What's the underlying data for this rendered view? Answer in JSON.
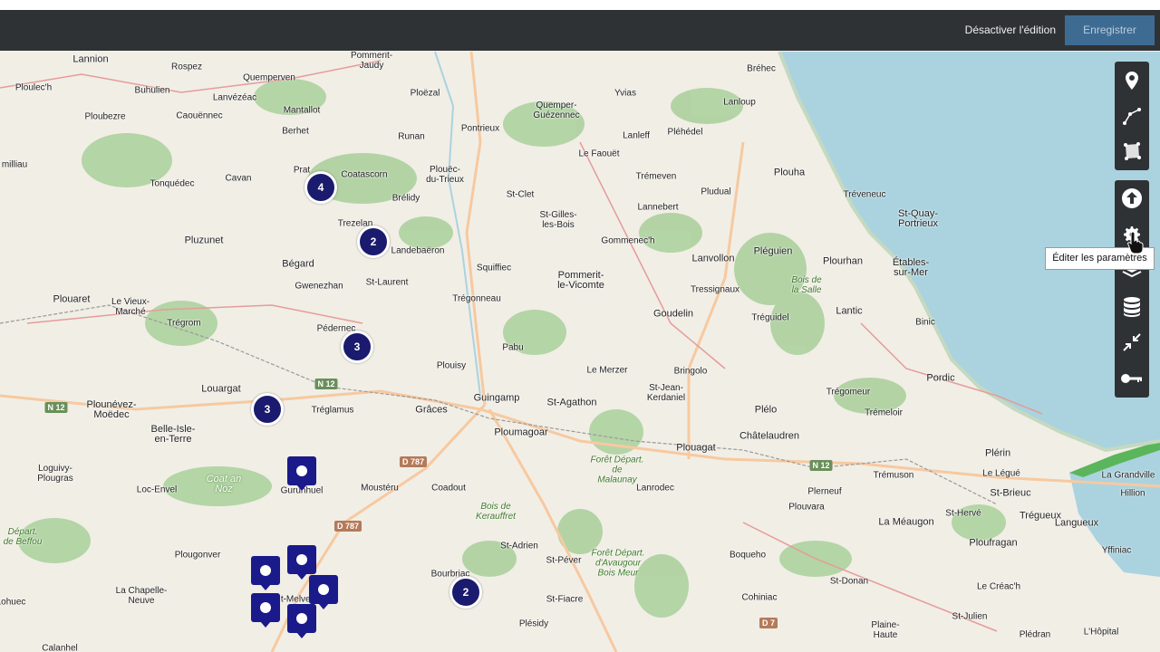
{
  "header": {
    "disable_edit_label": "Désactiver l'édition",
    "save_label": "Enregistrer"
  },
  "tooltip": {
    "text": "Éditer les paramètres"
  },
  "toolbar_top": {
    "icons": [
      "marker-pin-icon",
      "polyline-icon",
      "polygon-icon"
    ]
  },
  "toolbar_bottom": {
    "icons": [
      "upload-icon",
      "gear-icon",
      "layers-icon",
      "database-icon",
      "shrink-icon",
      "key-icon"
    ]
  },
  "places": [
    {
      "name": "Lannion"
    },
    {
      "name": "Rospez"
    },
    {
      "name": "Pommerit-\nJaudy"
    },
    {
      "name": "Quemperven"
    },
    {
      "name": "Ploulec'h"
    },
    {
      "name": "Buhulien"
    },
    {
      "name": "Lanvézéac"
    },
    {
      "name": "Ploubezre"
    },
    {
      "name": "Caouënnec"
    },
    {
      "name": "Mantallot"
    },
    {
      "name": "Berhet"
    },
    {
      "name": "Ploëzal"
    },
    {
      "name": "Runan"
    },
    {
      "name": "Pontrieux"
    },
    {
      "name": "Quemper-\nGuézennec"
    },
    {
      "name": "Yvias"
    },
    {
      "name": "Lanloup"
    },
    {
      "name": "Bréhec"
    },
    {
      "name": "Lanleff"
    },
    {
      "name": "Pléhédel"
    },
    {
      "name": "Le Faouët"
    },
    {
      "name": "Trémeven"
    },
    {
      "name": "Plouha"
    },
    {
      "name": "Tréveneuc"
    },
    {
      "name": "Pludual"
    },
    {
      "name": "Lannebert"
    },
    {
      "name": "Gommenec'h"
    },
    {
      "name": "Plouëc-\ndu-Trieux"
    },
    {
      "name": "St-Clet"
    },
    {
      "name": "St-Gilles-\nles-Bois"
    },
    {
      "name": "Coatascorn"
    },
    {
      "name": "Prat"
    },
    {
      "name": "Tonquédec"
    },
    {
      "name": "Cavan"
    },
    {
      "name": "milliau"
    },
    {
      "name": "Brélidy"
    },
    {
      "name": "Trezelan"
    },
    {
      "name": "Landebaëron"
    },
    {
      "name": "Pluzunet"
    },
    {
      "name": "Bégard"
    },
    {
      "name": "Gwenezhan"
    },
    {
      "name": "St-Laurent"
    },
    {
      "name": "Squiffiec"
    },
    {
      "name": "Trégonneau"
    },
    {
      "name": "Pommerit-\nle-Vicomte"
    },
    {
      "name": "Lanvollon"
    },
    {
      "name": "Pléguien"
    },
    {
      "name": "Plourhan"
    },
    {
      "name": "Étables-\nsur-Mer"
    },
    {
      "name": "St-Quay-\nPortrieux"
    },
    {
      "name": "Tressignaux"
    },
    {
      "name": "Tréguidel"
    },
    {
      "name": "Lantic"
    },
    {
      "name": "Binic"
    },
    {
      "name": "Goudelin"
    },
    {
      "name": "Plouaret"
    },
    {
      "name": "Le Vieux-\nMarché"
    },
    {
      "name": "Trégrom"
    },
    {
      "name": "Pédernec"
    },
    {
      "name": "Pabu"
    },
    {
      "name": "Plouisy"
    },
    {
      "name": "Le Merzer"
    },
    {
      "name": "Bringolo"
    },
    {
      "name": "Pordic"
    },
    {
      "name": "Trégomeur"
    },
    {
      "name": "St-Jean-\nKerdaniel"
    },
    {
      "name": "Louargat"
    },
    {
      "name": "Guingamp"
    },
    {
      "name": "St-Agathon"
    },
    {
      "name": "Plélo"
    },
    {
      "name": "Trémeloir"
    },
    {
      "name": "Plounévez-\nMoëdec"
    },
    {
      "name": "Tréglamus"
    },
    {
      "name": "Grâces"
    },
    {
      "name": "Ploumagoar"
    },
    {
      "name": "Plouagat"
    },
    {
      "name": "Châtelaudren"
    },
    {
      "name": "Belle-Isle-\nen-Terre"
    },
    {
      "name": "Plérin"
    },
    {
      "name": "Trémuson"
    },
    {
      "name": "Le Légué"
    },
    {
      "name": "St-Brieuc"
    },
    {
      "name": "La Grandville"
    },
    {
      "name": "Hillion"
    },
    {
      "name": "Loguivy-\nPlougras"
    },
    {
      "name": "Loc-Envel"
    },
    {
      "name": "Gurunhuel"
    },
    {
      "name": "Moustéru"
    },
    {
      "name": "Coadout"
    },
    {
      "name": "Lanrodec"
    },
    {
      "name": "Plerneuf"
    },
    {
      "name": "Plouvara"
    },
    {
      "name": "La Méaugon"
    },
    {
      "name": "St-Hervé"
    },
    {
      "name": "Trégueux"
    },
    {
      "name": "Langueux"
    },
    {
      "name": "Yffiniac"
    },
    {
      "name": "Ploufragan"
    },
    {
      "name": "Plougonver"
    },
    {
      "name": "St-Adrien"
    },
    {
      "name": "St-Péver"
    },
    {
      "name": "Boqueho"
    },
    {
      "name": "La Chapelle-\nNeuve"
    },
    {
      "name": "Bourbriac"
    },
    {
      "name": "St-Fiacre"
    },
    {
      "name": "Cohiniac"
    },
    {
      "name": "St-Donan"
    },
    {
      "name": "Le Créac'h"
    },
    {
      "name": "Plésidy"
    },
    {
      "name": "Plaine-\nHaute"
    },
    {
      "name": "St-Julien"
    },
    {
      "name": "Calanhel"
    },
    {
      "name": "Plédran"
    },
    {
      "name": "L'Hôpital"
    },
    {
      "name": "Départ.\nde Beffou"
    },
    {
      "name": "t-Melven"
    },
    {
      "name": "Lohuec"
    },
    {
      "name": "Ploubezre"
    }
  ],
  "forests": [
    {
      "name": "Bois de\nla Salle"
    },
    {
      "name": "Bois de\nKerauffret"
    },
    {
      "name": "Forêt Départ.\nde\nMalaunay"
    },
    {
      "name": "Forêt Départ.\nd'Avaugour\nBois Meur"
    },
    {
      "name": "Coat an\nNoz"
    }
  ],
  "roads": [
    {
      "label": "N 12"
    },
    {
      "label": "N 12"
    },
    {
      "label": "N 12"
    },
    {
      "label": "D 787"
    },
    {
      "label": "D 787"
    },
    {
      "label": "D 7"
    }
  ],
  "clusters": [
    {
      "count": "4"
    },
    {
      "count": "2"
    },
    {
      "count": "3"
    },
    {
      "count": "3"
    },
    {
      "count": "2"
    }
  ],
  "markers_count": 6
}
